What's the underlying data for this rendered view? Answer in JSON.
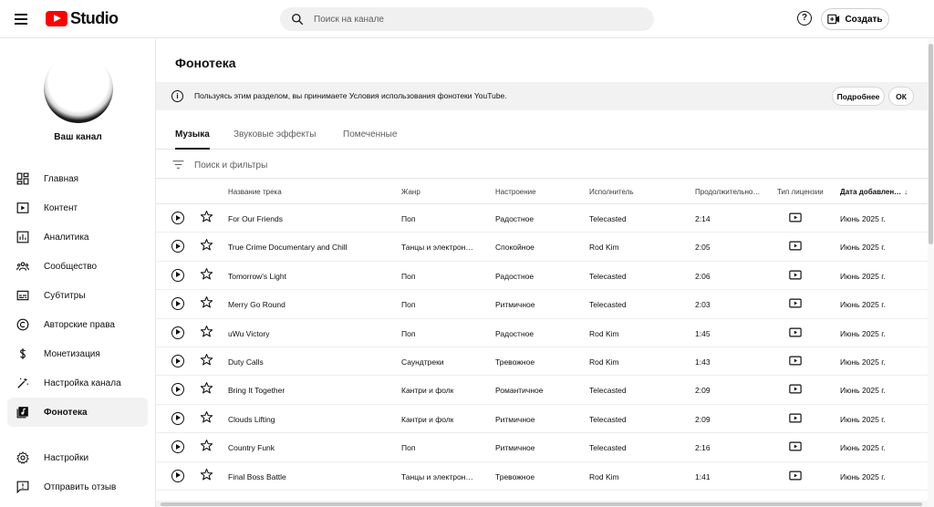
{
  "header": {
    "logo_text": "Studio",
    "search_placeholder": "Поиск на канале",
    "help_label": "?",
    "create_label": "Создать"
  },
  "sidebar": {
    "channel_label": "Ваш канал",
    "items": [
      {
        "label": "Главная",
        "icon": "dashboard-icon"
      },
      {
        "label": "Контент",
        "icon": "content-icon"
      },
      {
        "label": "Аналитика",
        "icon": "analytics-icon"
      },
      {
        "label": "Сообщество",
        "icon": "community-icon"
      },
      {
        "label": "Субтитры",
        "icon": "subtitles-icon"
      },
      {
        "label": "Авторские права",
        "icon": "copyright-icon"
      },
      {
        "label": "Монетизация",
        "icon": "monetization-icon"
      },
      {
        "label": "Настройка канала",
        "icon": "customization-icon"
      },
      {
        "label": "Фонотека",
        "icon": "audio-library-icon",
        "active": true
      }
    ],
    "bottom_items": [
      {
        "label": "Настройки",
        "icon": "settings-icon"
      },
      {
        "label": "Отправить отзыв",
        "icon": "feedback-icon"
      }
    ]
  },
  "main": {
    "title": "Фонотека",
    "banner": {
      "info_glyph": "i",
      "text": "Пользуясь этим разделом, вы принимаете Условия использования фонотеки YouTube.",
      "more_label": "Подробнее",
      "ok_label": "ОК"
    },
    "tabs": [
      {
        "label": "Музыка",
        "active": true
      },
      {
        "label": "Звуковые эффекты"
      },
      {
        "label": "Помеченные"
      }
    ],
    "filter_placeholder": "Поиск и фильтры",
    "columns": {
      "title": "Название трека",
      "genre": "Жанр",
      "mood": "Настроение",
      "artist": "Исполнитель",
      "duration": "Продолжительно…",
      "license": "Тип лицензии",
      "date": "Дата добавлен…",
      "sort_arrow": "↓"
    },
    "tracks": [
      {
        "title": "For Our Friends",
        "genre": "Поп",
        "mood": "Радостное",
        "artist": "Telecasted",
        "duration": "2:14",
        "date": "Июнь 2025 г."
      },
      {
        "title": "True Crime Documentary and Chill",
        "genre": "Танцы и электрон…",
        "mood": "Спокойное",
        "artist": "Rod Kim",
        "duration": "2:05",
        "date": "Июнь 2025 г."
      },
      {
        "title": "Tomorrow's Light",
        "genre": "Поп",
        "mood": "Радостное",
        "artist": "Telecasted",
        "duration": "2:06",
        "date": "Июнь 2025 г."
      },
      {
        "title": "Merry Go Round",
        "genre": "Поп",
        "mood": "Ритмичное",
        "artist": "Telecasted",
        "duration": "2:03",
        "date": "Июнь 2025 г."
      },
      {
        "title": "uWu Victory",
        "genre": "Поп",
        "mood": "Радостное",
        "artist": "Rod Kim",
        "duration": "1:45",
        "date": "Июнь 2025 г."
      },
      {
        "title": "Duty Calls",
        "genre": "Саундтреки",
        "mood": "Тревожное",
        "artist": "Rod Kim",
        "duration": "1:43",
        "date": "Июнь 2025 г."
      },
      {
        "title": "Bring It Together",
        "genre": "Кантри и фолк",
        "mood": "Романтичное",
        "artist": "Telecasted",
        "duration": "2:09",
        "date": "Июнь 2025 г."
      },
      {
        "title": "Clouds Lifting",
        "genre": "Кантри и фолк",
        "mood": "Ритмичное",
        "artist": "Telecasted",
        "duration": "2:09",
        "date": "Июнь 2025 г."
      },
      {
        "title": "Country Funk",
        "genre": "Поп",
        "mood": "Ритмичное",
        "artist": "Telecasted",
        "duration": "2:16",
        "date": "Июнь 2025 г."
      },
      {
        "title": "Final Boss Battle",
        "genre": "Танцы и электрон…",
        "mood": "Тревожное",
        "artist": "Rod Kim",
        "duration": "1:41",
        "date": "Июнь 2025 г."
      }
    ]
  }
}
